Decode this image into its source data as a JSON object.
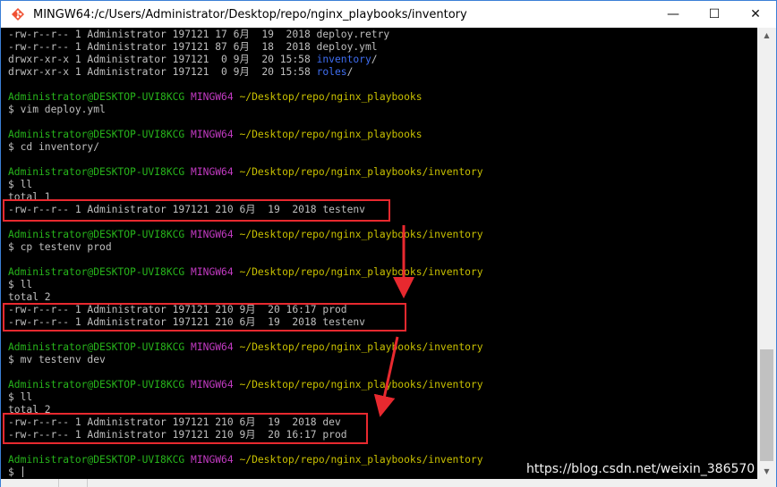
{
  "window": {
    "title": "MINGW64:/c/Users/Administrator/Desktop/repo/nginx_playbooks/inventory",
    "icon": "git-bash-icon",
    "controls": {
      "minimize": "—",
      "maximize": "☐",
      "close": "✕"
    }
  },
  "terminal": {
    "lines": [
      {
        "segments": [
          {
            "text": "-rw-r--r-- 1 Administrator 197121 17 6月  19  2018 deploy.retry",
            "color": "default"
          }
        ]
      },
      {
        "segments": [
          {
            "text": "-rw-r--r-- 1 Administrator 197121 87 6月  18  2018 deploy.yml",
            "color": "default"
          }
        ]
      },
      {
        "segments": [
          {
            "text": "drwxr-xr-x 1 Administrator 197121  0 9月  20 15:58 ",
            "color": "default"
          },
          {
            "text": "inventory",
            "color": "blue"
          },
          {
            "text": "/",
            "color": "default"
          }
        ]
      },
      {
        "segments": [
          {
            "text": "drwxr-xr-x 1 Administrator 197121  0 9月  20 15:58 ",
            "color": "default"
          },
          {
            "text": "roles",
            "color": "blue"
          },
          {
            "text": "/",
            "color": "default"
          }
        ]
      },
      {
        "segments": [
          {
            "text": "",
            "color": "default"
          }
        ]
      },
      {
        "segments": [
          {
            "text": "Administrator@DESKTOP-UVI8KCG ",
            "color": "green"
          },
          {
            "text": "MINGW64 ",
            "color": "magenta"
          },
          {
            "text": "~/Desktop/repo/nginx_playbooks",
            "color": "yellow"
          }
        ]
      },
      {
        "segments": [
          {
            "text": "$ vim deploy.yml",
            "color": "default"
          }
        ]
      },
      {
        "segments": [
          {
            "text": "",
            "color": "default"
          }
        ]
      },
      {
        "segments": [
          {
            "text": "Administrator@DESKTOP-UVI8KCG ",
            "color": "green"
          },
          {
            "text": "MINGW64 ",
            "color": "magenta"
          },
          {
            "text": "~/Desktop/repo/nginx_playbooks",
            "color": "yellow"
          }
        ]
      },
      {
        "segments": [
          {
            "text": "$ cd inventory/",
            "color": "default"
          }
        ]
      },
      {
        "segments": [
          {
            "text": "",
            "color": "default"
          }
        ]
      },
      {
        "segments": [
          {
            "text": "Administrator@DESKTOP-UVI8KCG ",
            "color": "green"
          },
          {
            "text": "MINGW64 ",
            "color": "magenta"
          },
          {
            "text": "~/Desktop/repo/nginx_playbooks/inventory",
            "color": "yellow"
          }
        ]
      },
      {
        "segments": [
          {
            "text": "$ ll",
            "color": "default"
          }
        ]
      },
      {
        "segments": [
          {
            "text": "total 1",
            "color": "default"
          }
        ]
      },
      {
        "segments": [
          {
            "text": "-rw-r--r-- 1 Administrator 197121 210 6月  19  2018 testenv",
            "color": "default"
          }
        ]
      },
      {
        "segments": [
          {
            "text": "",
            "color": "default"
          }
        ]
      },
      {
        "segments": [
          {
            "text": "Administrator@DESKTOP-UVI8KCG ",
            "color": "green"
          },
          {
            "text": "MINGW64 ",
            "color": "magenta"
          },
          {
            "text": "~/Desktop/repo/nginx_playbooks/inventory",
            "color": "yellow"
          }
        ]
      },
      {
        "segments": [
          {
            "text": "$ cp testenv prod",
            "color": "default"
          }
        ]
      },
      {
        "segments": [
          {
            "text": "",
            "color": "default"
          }
        ]
      },
      {
        "segments": [
          {
            "text": "Administrator@DESKTOP-UVI8KCG ",
            "color": "green"
          },
          {
            "text": "MINGW64 ",
            "color": "magenta"
          },
          {
            "text": "~/Desktop/repo/nginx_playbooks/inventory",
            "color": "yellow"
          }
        ]
      },
      {
        "segments": [
          {
            "text": "$ ll",
            "color": "default"
          }
        ]
      },
      {
        "segments": [
          {
            "text": "total 2",
            "color": "default"
          }
        ]
      },
      {
        "segments": [
          {
            "text": "-rw-r--r-- 1 Administrator 197121 210 9月  20 16:17 prod",
            "color": "default"
          }
        ]
      },
      {
        "segments": [
          {
            "text": "-rw-r--r-- 1 Administrator 197121 210 6月  19  2018 testenv",
            "color": "default"
          }
        ]
      },
      {
        "segments": [
          {
            "text": "",
            "color": "default"
          }
        ]
      },
      {
        "segments": [
          {
            "text": "Administrator@DESKTOP-UVI8KCG ",
            "color": "green"
          },
          {
            "text": "MINGW64 ",
            "color": "magenta"
          },
          {
            "text": "~/Desktop/repo/nginx_playbooks/inventory",
            "color": "yellow"
          }
        ]
      },
      {
        "segments": [
          {
            "text": "$ mv testenv dev",
            "color": "default"
          }
        ]
      },
      {
        "segments": [
          {
            "text": "",
            "color": "default"
          }
        ]
      },
      {
        "segments": [
          {
            "text": "Administrator@DESKTOP-UVI8KCG ",
            "color": "green"
          },
          {
            "text": "MINGW64 ",
            "color": "magenta"
          },
          {
            "text": "~/Desktop/repo/nginx_playbooks/inventory",
            "color": "yellow"
          }
        ]
      },
      {
        "segments": [
          {
            "text": "$ ll",
            "color": "default"
          }
        ]
      },
      {
        "segments": [
          {
            "text": "total 2",
            "color": "default"
          }
        ]
      },
      {
        "segments": [
          {
            "text": "-rw-r--r-- 1 Administrator 197121 210 6月  19  2018 dev",
            "color": "default"
          }
        ]
      },
      {
        "segments": [
          {
            "text": "-rw-r--r-- 1 Administrator 197121 210 9月  20 16:17 prod",
            "color": "default"
          }
        ]
      },
      {
        "segments": [
          {
            "text": "",
            "color": "default"
          }
        ]
      },
      {
        "segments": [
          {
            "text": "Administrator@DESKTOP-UVI8KCG ",
            "color": "green"
          },
          {
            "text": "MINGW64 ",
            "color": "magenta"
          },
          {
            "text": "~/Desktop/repo/nginx_playbooks/inventory",
            "color": "yellow"
          }
        ]
      },
      {
        "segments": [
          {
            "text": "$ ",
            "color": "default"
          }
        ],
        "cursor": true
      }
    ]
  },
  "colors": {
    "default": "#bfbfbf",
    "green": "#27b51b",
    "magenta": "#c33bc3",
    "yellow": "#c8c000",
    "blue": "#3f6ef2",
    "highlight": "#e8292f"
  },
  "watermark": "https://blog.csdn.net/weixin_386570"
}
